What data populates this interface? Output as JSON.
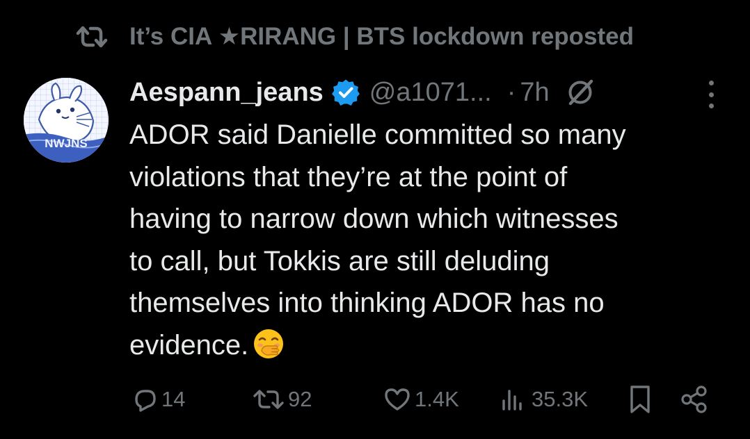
{
  "repost_banner": {
    "icon": "repost-icon",
    "text": "It’s CIA ★RIRANG | BTS lockdown reposted"
  },
  "author": {
    "display_name": "Aespann_jeans",
    "verified": true,
    "handle": "@a1071...",
    "separator": "·",
    "time": "7h",
    "avatar_label": "NWJNS"
  },
  "post": {
    "lines": [
      "ADOR said Danielle committed so many",
      "violations that they’re at the point of",
      "having to narrow down which witnesses",
      "to call, but Tokkis are still deluding",
      "themselves into thinking ADOR has no",
      "evidence."
    ],
    "emoji": "face-with-hand-over-mouth"
  },
  "actions": {
    "replies": "14",
    "reposts": "92",
    "likes": "1.4K",
    "views": "35.3K"
  },
  "colors": {
    "background": "#000000",
    "text": "#e7e9ea",
    "muted": "#71767b",
    "verified": "#1d9bf0"
  }
}
